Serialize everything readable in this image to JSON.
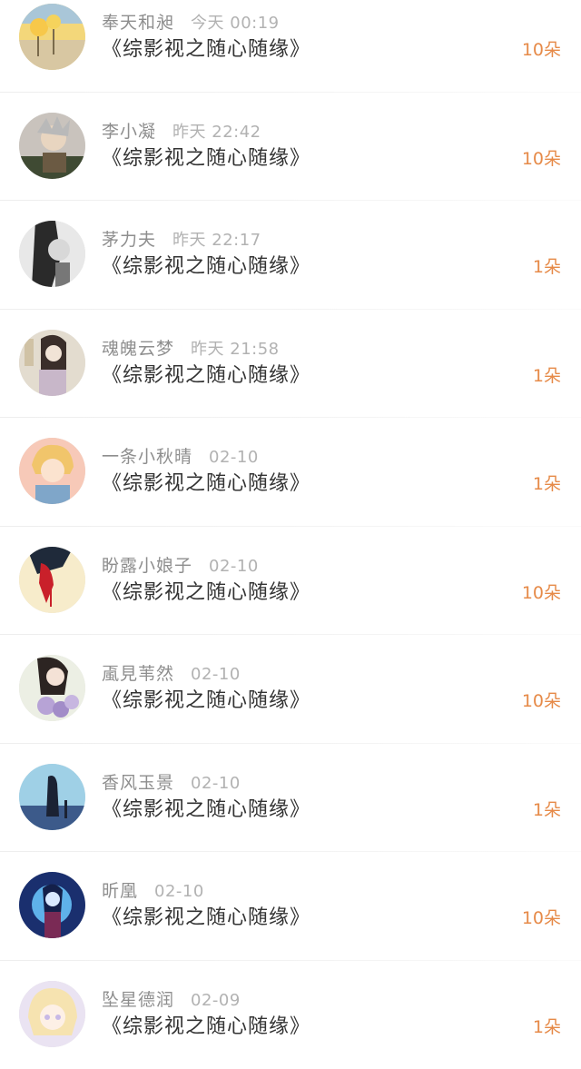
{
  "rows": [
    {
      "nickname": "奉天和昶",
      "time": "今天 00:19",
      "book": "《综影视之随心随缘》",
      "gift": "10朵",
      "avatar_colors": [
        "#f3d77a",
        "#d8c7a2",
        "#a9c6d8"
      ]
    },
    {
      "nickname": "李小凝",
      "time": "昨天 22:42",
      "book": "《综影视之随心随缘》",
      "gift": "10朵",
      "avatar_colors": [
        "#c9c3bd",
        "#6b5a43",
        "#3f4a33"
      ]
    },
    {
      "nickname": "茅力夫",
      "time": "昨天 22:17",
      "book": "《综影视之随心随缘》",
      "gift": "1朵",
      "avatar_colors": [
        "#e8e8e8",
        "#2a2a2a",
        "#777777"
      ]
    },
    {
      "nickname": "魂魄云梦",
      "time": "昨天 21:58",
      "book": "《综影视之随心随缘》",
      "gift": "1朵",
      "avatar_colors": [
        "#e3dccf",
        "#3a2e2a",
        "#c8b7c9"
      ]
    },
    {
      "nickname": "一条小秋晴",
      "time": "02-10",
      "book": "《综影视之随心随缘》",
      "gift": "1朵",
      "avatar_colors": [
        "#f7c9b8",
        "#f1c56b",
        "#7fa6c9"
      ]
    },
    {
      "nickname": "盼露小娘子",
      "time": "02-10",
      "book": "《综影视之随心随缘》",
      "gift": "10朵",
      "avatar_colors": [
        "#f7eccb",
        "#1f2a3a",
        "#c9202a"
      ]
    },
    {
      "nickname": "颪見苇然",
      "time": "02-10",
      "book": "《综影视之随心随缘》",
      "gift": "10朵",
      "avatar_colors": [
        "#ecefe4",
        "#2c2422",
        "#b7a3d6"
      ]
    },
    {
      "nickname": "香风玉景",
      "time": "02-10",
      "book": "《综影视之随心随缘》",
      "gift": "1朵",
      "avatar_colors": [
        "#9fd0e6",
        "#3c5a8a",
        "#1b2233"
      ]
    },
    {
      "nickname": "昕凰",
      "time": "02-10",
      "book": "《综影视之随心随缘》",
      "gift": "10朵",
      "avatar_colors": [
        "#1a2f6e",
        "#5fb2ea",
        "#d9e9ff"
      ]
    },
    {
      "nickname": "坠星德润",
      "time": "02-09",
      "book": "《综影视之随心随缘》",
      "gift": "1朵",
      "avatar_colors": [
        "#eae3f2",
        "#f6e3b0",
        "#c7b8e6"
      ]
    }
  ]
}
